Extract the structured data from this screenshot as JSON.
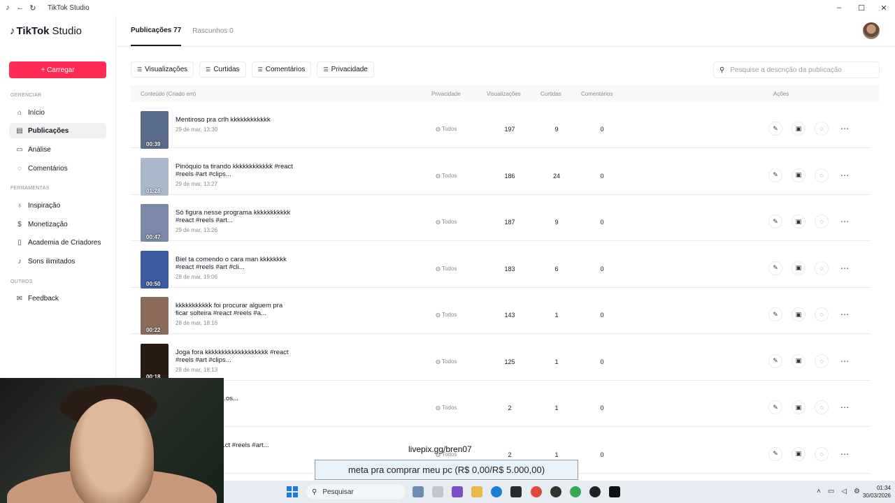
{
  "window": {
    "title": "TikTok Studio",
    "controls": [
      "–",
      "☐",
      "✕"
    ]
  },
  "logo": {
    "brand": "TikTok",
    "product": "Studio"
  },
  "sidebar": {
    "upload_label": "+ Carregar",
    "sections": [
      {
        "title": "GERENCIAR",
        "items": [
          {
            "label": "Início",
            "icon": "home-icon"
          },
          {
            "label": "Publicações",
            "icon": "posts-icon",
            "active": true
          },
          {
            "label": "Análise",
            "icon": "analytics-icon"
          },
          {
            "label": "Comentários",
            "icon": "comments-icon"
          }
        ]
      },
      {
        "title": "FERRAMENTAS",
        "items": [
          {
            "label": "Inspiração",
            "icon": "bulb-icon"
          },
          {
            "label": "Monetização",
            "icon": "money-icon"
          },
          {
            "label": "Academia de Criadores",
            "icon": "book-icon"
          },
          {
            "label": "Sons ilimitados",
            "icon": "music-icon"
          }
        ]
      },
      {
        "title": "OUTROS",
        "items": [
          {
            "label": "Feedback",
            "icon": "feedback-icon"
          }
        ]
      }
    ]
  },
  "tabs": [
    {
      "label": "Publicações 77",
      "active": true
    },
    {
      "label": "Rascunhos 0",
      "active": false
    }
  ],
  "filters": [
    "Visualizações",
    "Curtidas",
    "Comentários",
    "Privacidade"
  ],
  "search": {
    "placeholder": "Pesquise a descrição da publicação"
  },
  "table": {
    "headers": {
      "content": "Conteúdo (Criado em)",
      "privacy": "Privacidade",
      "views": "Visualizações",
      "likes": "Curtidas",
      "comments": "Comentários",
      "actions": "Ações"
    },
    "rows": [
      {
        "caption": "Mentiroso pra crlh kkkkkkkkkkkk",
        "date": "29 de mar, 13:30",
        "duration": "00:39",
        "privacy": "Todos",
        "views": "197",
        "likes": "9",
        "comments": "0",
        "thumb_color": "#5a6a8a"
      },
      {
        "caption": "Pinóquio ta tirando kkkkkkkkkkkk #react #reels #art #clips...",
        "date": "29 de mar, 13:27",
        "duration": "01:28",
        "privacy": "Todos",
        "views": "186",
        "likes": "24",
        "comments": "0",
        "thumb_color": "#a9b9c9"
      },
      {
        "caption": "Só figura nesse programa kkkkkkkkkkk #react #reels #art...",
        "date": "29 de mar, 13:26",
        "duration": "00:47",
        "privacy": "Todos",
        "views": "187",
        "likes": "9",
        "comments": "0",
        "thumb_color": "#7a8aa8"
      },
      {
        "caption": "Biel ta comendo o cara man kkkkkkkk #react #reels #art #cli...",
        "date": "28 de mar, 19:06",
        "duration": "00:50",
        "privacy": "Todos",
        "views": "183",
        "likes": "6",
        "comments": "0",
        "thumb_color": "#3b5aa0"
      },
      {
        "caption": "kkkkkkkkkkk foi procurar alguem pra ficar solteira #react #reels #a...",
        "date": "28 de mar, 18:16",
        "duration": "00:22",
        "privacy": "Todos",
        "views": "143",
        "likes": "1",
        "comments": "0",
        "thumb_color": "#8c6a5a"
      },
      {
        "caption": "Joga fora kkkkkkkkkkkkkkkkkkk #react #reels #art #clips...",
        "date": "28 de mar, 18:13",
        "duration": "00:18",
        "privacy": "Todos",
        "views": "125",
        "likes": "1",
        "comments": "0",
        "thumb_color": "#2a1a14"
      },
      {
        "caption": "to pik@ #react ...os...",
        "date": "",
        "duration": "",
        "privacy": "Todos",
        "views": "2",
        "likes": "1",
        "comments": "0",
        "thumb_color": "#444444"
      },
      {
        "caption": "...eja diferente ...ct #reels #art...",
        "date": "",
        "duration": "",
        "privacy": "Todos",
        "views": "2",
        "likes": "1",
        "comments": "0",
        "thumb_color": "#444444"
      }
    ]
  },
  "overlay": {
    "link": "livepix.gg/bren07",
    "goal": "meta pra comprar meu pc (R$ 0,00/R$ 5.000,00)"
  },
  "taskbar": {
    "search_label": "Pesquisar",
    "time": "01:34",
    "date": "30/03/2026"
  }
}
